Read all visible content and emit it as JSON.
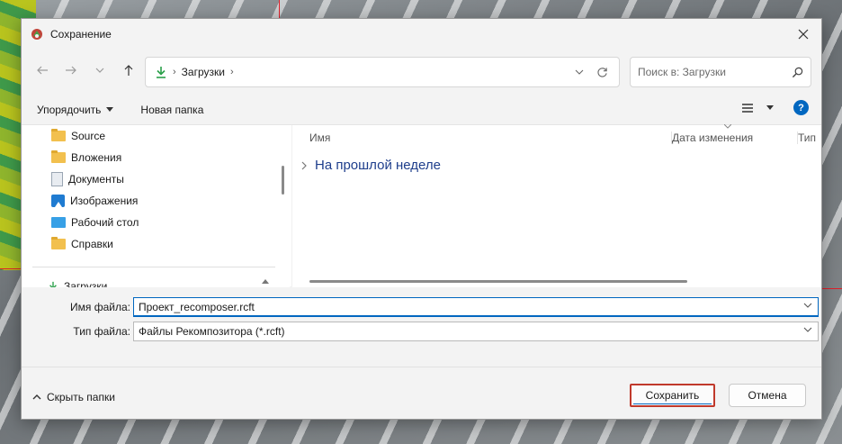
{
  "window": {
    "title": "Сохранение",
    "close_icon": "close-icon"
  },
  "nav": {
    "back_icon": "arrow-left-icon",
    "forward_icon": "arrow-right-icon",
    "recent_icon": "chevron-down-icon",
    "up_icon": "arrow-up-icon"
  },
  "address": {
    "location_icon": "download-icon",
    "crumb": "Загрузки",
    "separator": "›"
  },
  "search": {
    "placeholder": "Поиск в: Загрузки",
    "icon": "search-icon"
  },
  "toolbar": {
    "organize_label": "Упорядочить",
    "new_folder_label": "Новая папка",
    "view_icon": "view-list-icon",
    "help_label": "?"
  },
  "sidebar": {
    "items": [
      {
        "label": "Source",
        "icon": "folder-icon"
      },
      {
        "label": "Вложения",
        "icon": "folder-icon"
      },
      {
        "label": "Документы",
        "icon": "documents-icon"
      },
      {
        "label": "Изображения",
        "icon": "pictures-icon"
      },
      {
        "label": "Рабочий стол",
        "icon": "desktop-icon"
      },
      {
        "label": "Справки",
        "icon": "folder-icon"
      }
    ],
    "partial_item": "Загрузки"
  },
  "files": {
    "columns": [
      "Имя",
      "Дата изменения",
      "Тип"
    ],
    "group_label": "На прошлой неделе"
  },
  "form": {
    "filename_label": "Имя файла:",
    "filename_value": "Проект_recomposer.rcft",
    "filetype_label": "Тип файла:",
    "filetype_value": "Файлы Рекомпозитора (*.rcft)"
  },
  "footer": {
    "hide_folders_label": "Скрыть папки",
    "save_label": "Сохранить",
    "cancel_label": "Отмена"
  },
  "colors": {
    "accent": "#0067c0",
    "save_outline": "#c0392b",
    "group_text": "#1e3e8c"
  }
}
